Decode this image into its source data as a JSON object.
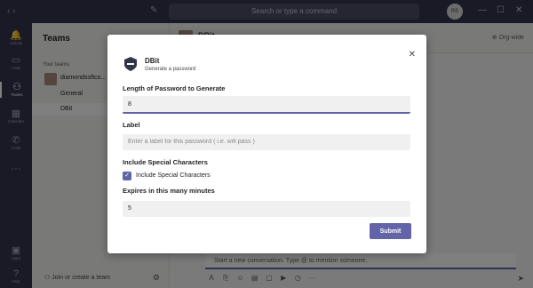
{
  "titlebar": {
    "search_placeholder": "Search or type a command",
    "avatar_initials": "RS",
    "minimize": "—",
    "maximize": "☐",
    "close": "✕"
  },
  "rail": {
    "items": [
      {
        "label": "Activity",
        "icon": "bell-icon"
      },
      {
        "label": "Chat",
        "icon": "chat-icon"
      },
      {
        "label": "Teams",
        "icon": "teams-icon"
      },
      {
        "label": "Calendar",
        "icon": "calendar-icon"
      },
      {
        "label": "Calls",
        "icon": "phone-icon"
      },
      {
        "label": "Apps",
        "icon": "apps-icon"
      },
      {
        "label": "Help",
        "icon": "help-icon"
      }
    ],
    "more": "···"
  },
  "teams_panel": {
    "title": "Teams",
    "your_teams": "Your teams",
    "team_name": "diamondsoftco...",
    "channels": [
      "General",
      "DBit"
    ],
    "join_label": "Join or create a team"
  },
  "main": {
    "title": "DBit",
    "org_wide": "⊕ Org-wide",
    "compose_placeholder": "Start a new conversation. Type @ to mention someone."
  },
  "dialog": {
    "app_name": "DBit",
    "app_subtitle": "Generate a password",
    "close_icon": "✕",
    "length_label": "Length of Password to Generate",
    "length_value": "8",
    "label_label": "Label",
    "label_placeholder": "Enter a label for this password ( i.e. wifi pass )",
    "special_label": "Include Special Characters",
    "special_checkbox_label": "Include Special Characters",
    "special_checked": true,
    "expires_label": "Expires in this many minutes",
    "expires_value": "5",
    "submit_label": "Submit"
  },
  "colors": {
    "accent": "#6264a7",
    "rail": "#33344a",
    "overlay": "rgba(0,0,0,0.5)"
  }
}
